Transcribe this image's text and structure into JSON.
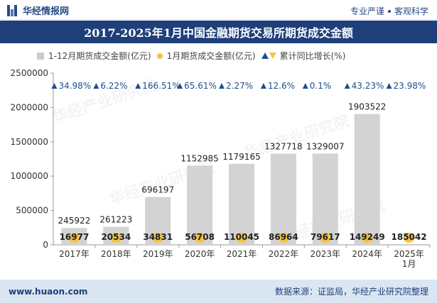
{
  "header": {
    "brand_name": "华经情报网",
    "badge_1": "专业严谨",
    "badge_2": "客观科学"
  },
  "footer": {
    "website": "www.huaon.com",
    "source": "数据来源：证监局，华经产业研究院整理"
  },
  "watermark": "华经产业研究院",
  "colors": {
    "title_band": "#1f3f7a",
    "bar": "#d3d3d3",
    "bubble": "#f5c242",
    "growth_up": "#1f4e8c",
    "footer_band": "#dbe6f3"
  },
  "chart_data": {
    "type": "bar",
    "title": "2017-2025年1月中国金融期货交易所期货成交金额",
    "categories": [
      "2017年",
      "2018年",
      "2019年",
      "2020年",
      "2021年",
      "2022年",
      "2023年",
      "2024年",
      "2025年1月"
    ],
    "category_lines": [
      [
        "2017年"
      ],
      [
        "2018年"
      ],
      [
        "2019年"
      ],
      [
        "2020年"
      ],
      [
        "2021年"
      ],
      [
        "2022年"
      ],
      [
        "2023年"
      ],
      [
        "2024年"
      ],
      [
        "2025年",
        "1月"
      ]
    ],
    "series": [
      {
        "name": "1-12月期货成交金额(亿元)",
        "values": [
          245922,
          261223,
          696197,
          1152985,
          1179165,
          1327718,
          1329007,
          1903522,
          null
        ],
        "labels": [
          "245922",
          "261223",
          "696197",
          "1152985",
          "1179165",
          "1327718",
          "1329007",
          "1903522",
          ""
        ]
      },
      {
        "name": "1月期货成交金额(亿元)",
        "values": [
          16977,
          20534,
          34831,
          56708,
          110045,
          86964,
          79617,
          149249,
          185042
        ],
        "labels": [
          "16977",
          "20534",
          "34831",
          "56708",
          "110045",
          "86964",
          "79617",
          "149249",
          "185042"
        ]
      },
      {
        "name": "累计同比增长(%)",
        "values": [
          34.98,
          6.22,
          166.51,
          65.61,
          2.27,
          12.6,
          0.1,
          43.23,
          23.98
        ],
        "labels": [
          "34.98%",
          "6.22%",
          "166.51%",
          "65.61%",
          "2.27%",
          "12.6%",
          "0.1%",
          "43.23%",
          "23.98%"
        ]
      }
    ],
    "legend_position": "top-left",
    "ylim": [
      0,
      2500000
    ],
    "yticks": [
      0,
      500000,
      1000000,
      1500000,
      2000000,
      2500000
    ],
    "ytick_labels": [
      "0",
      "500000",
      "1000000",
      "1500000",
      "2000000",
      "2500000"
    ],
    "grid": false
  }
}
